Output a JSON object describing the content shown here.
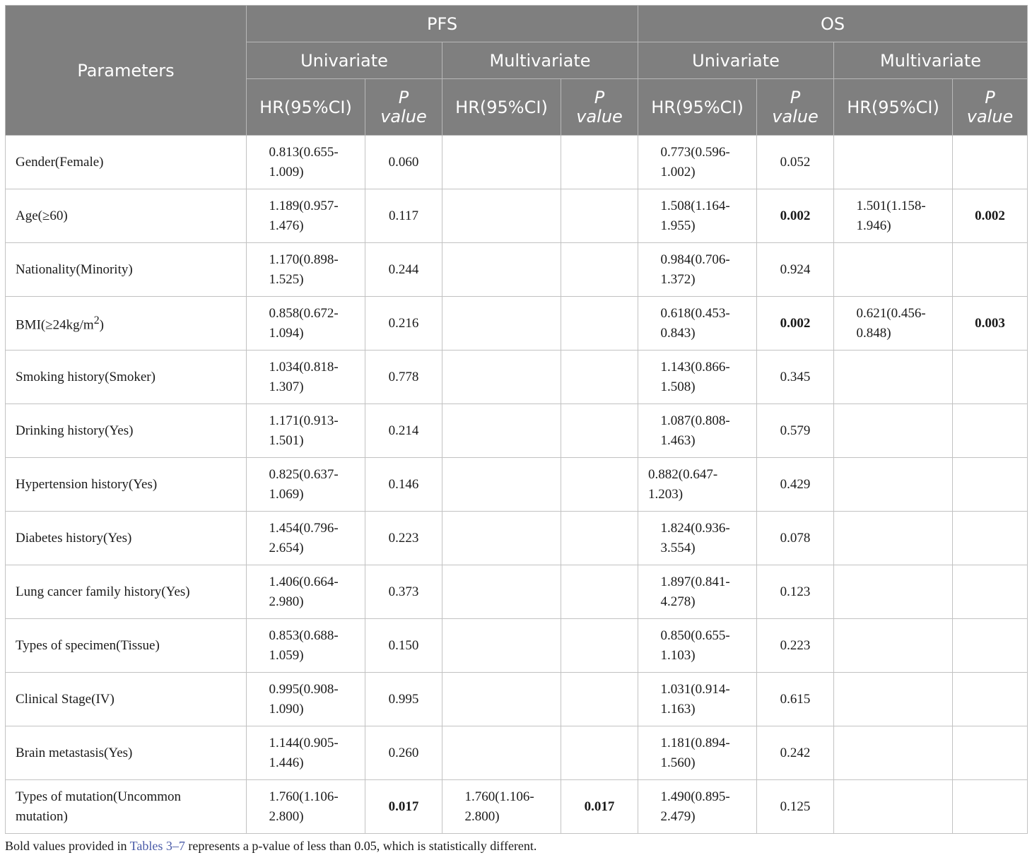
{
  "header": {
    "parameters": "Parameters",
    "pfs": "PFS",
    "os": "OS",
    "univariate": "Univariate",
    "multivariate": "Multivariate",
    "hr": "HR(95%CI)",
    "p_line1": "P",
    "p_line2": "value"
  },
  "rows": [
    {
      "param": "Gender(Female)",
      "pfs_uni_hr": "0.813(0.655-1.009)",
      "pfs_uni_p": "0.060",
      "pfs_multi_hr": "",
      "pfs_multi_p": "",
      "os_uni_hr": "0.773(0.596-1.002)",
      "os_uni_p": "0.052",
      "os_multi_hr": "",
      "os_multi_p": ""
    },
    {
      "param": "Age(≥60)",
      "pfs_uni_hr": "1.189(0.957-1.476)",
      "pfs_uni_p": "0.117",
      "pfs_multi_hr": "",
      "pfs_multi_p": "",
      "os_uni_hr": "1.508(1.164-1.955)",
      "os_uni_p": "0.002",
      "os_multi_hr": "1.501(1.158-1.946)",
      "os_multi_p": "0.002"
    },
    {
      "param": "Nationality(Minority)",
      "pfs_uni_hr": "1.170(0.898-1.525)",
      "pfs_uni_p": "0.244",
      "pfs_multi_hr": "",
      "pfs_multi_p": "",
      "os_uni_hr": "0.984(0.706-1.372)",
      "os_uni_p": "0.924",
      "os_multi_hr": "",
      "os_multi_p": ""
    },
    {
      "param_base": "BMI(≥24kg/m",
      "param_sup": "2",
      "param_end": ")",
      "pfs_uni_hr": "0.858(0.672-1.094)",
      "pfs_uni_p": "0.216",
      "pfs_multi_hr": "",
      "pfs_multi_p": "",
      "os_uni_hr": "0.618(0.453-0.843)",
      "os_uni_p": "0.002",
      "os_multi_hr": "0.621(0.456-0.848)",
      "os_multi_p": "0.003"
    },
    {
      "param": "Smoking history(Smoker)",
      "pfs_uni_hr": "1.034(0.818-1.307)",
      "pfs_uni_p": "0.778",
      "pfs_multi_hr": "",
      "pfs_multi_p": "",
      "os_uni_hr": "1.143(0.866-1.508)",
      "os_uni_p": "0.345",
      "os_multi_hr": "",
      "os_multi_p": ""
    },
    {
      "param": "Drinking history(Yes)",
      "pfs_uni_hr": "1.171(0.913-1.501)",
      "pfs_uni_p": "0.214",
      "pfs_multi_hr": "",
      "pfs_multi_p": "",
      "os_uni_hr": "1.087(0.808-1.463)",
      "os_uni_p": "0.579",
      "os_multi_hr": "",
      "os_multi_p": ""
    },
    {
      "param": "Hypertension history(Yes)",
      "pfs_uni_hr": "0.825(0.637-1.069)",
      "pfs_uni_p": "0.146",
      "pfs_multi_hr": "",
      "pfs_multi_p": "",
      "os_uni_hr": "0.882(0.647-1.203)",
      "os_uni_p": "0.429",
      "os_multi_hr": "",
      "os_multi_p": ""
    },
    {
      "param": "Diabetes history(Yes)",
      "pfs_uni_hr": "1.454(0.796-2.654)",
      "pfs_uni_p": "0.223",
      "pfs_multi_hr": "",
      "pfs_multi_p": "",
      "os_uni_hr": "1.824(0.936-3.554)",
      "os_uni_p": "0.078",
      "os_multi_hr": "",
      "os_multi_p": ""
    },
    {
      "param": "Lung cancer family history(Yes)",
      "pfs_uni_hr": "1.406(0.664-2.980)",
      "pfs_uni_p": "0.373",
      "pfs_multi_hr": "",
      "pfs_multi_p": "",
      "os_uni_hr": "1.897(0.841-4.278)",
      "os_uni_p": "0.123",
      "os_multi_hr": "",
      "os_multi_p": ""
    },
    {
      "param": "Types of specimen(Tissue)",
      "pfs_uni_hr": "0.853(0.688-1.059)",
      "pfs_uni_p": "0.150",
      "pfs_multi_hr": "",
      "pfs_multi_p": "",
      "os_uni_hr": "0.850(0.655-1.103)",
      "os_uni_p": "0.223",
      "os_multi_hr": "",
      "os_multi_p": ""
    },
    {
      "param": "Clinical Stage(IV)",
      "pfs_uni_hr": "0.995(0.908-1.090)",
      "pfs_uni_p": "0.995",
      "pfs_multi_hr": "",
      "pfs_multi_p": "",
      "os_uni_hr": "1.031(0.914-1.163)",
      "os_uni_p": "0.615",
      "os_multi_hr": "",
      "os_multi_p": ""
    },
    {
      "param": "Brain metastasis(Yes)",
      "pfs_uni_hr": "1.144(0.905-1.446)",
      "pfs_uni_p": "0.260",
      "pfs_multi_hr": "",
      "pfs_multi_p": "",
      "os_uni_hr": "1.181(0.894-1.560)",
      "os_uni_p": "0.242",
      "os_multi_hr": "",
      "os_multi_p": ""
    },
    {
      "param": "Types of mutation(Uncommon mutation)",
      "pfs_uni_hr": "1.760(1.106-2.800)",
      "pfs_uni_p": "0.017",
      "pfs_multi_hr": "1.760(1.106-2.800)",
      "pfs_multi_p": "0.017",
      "os_uni_hr": "1.490(0.895-2.479)",
      "os_uni_p": "0.125",
      "os_multi_hr": "",
      "os_multi_p": ""
    }
  ],
  "footnote": {
    "part1": "Bold values provided in ",
    "link": "Tables 3–7",
    "part2": " represents a p-value of less than 0.05, which is statistically different."
  }
}
